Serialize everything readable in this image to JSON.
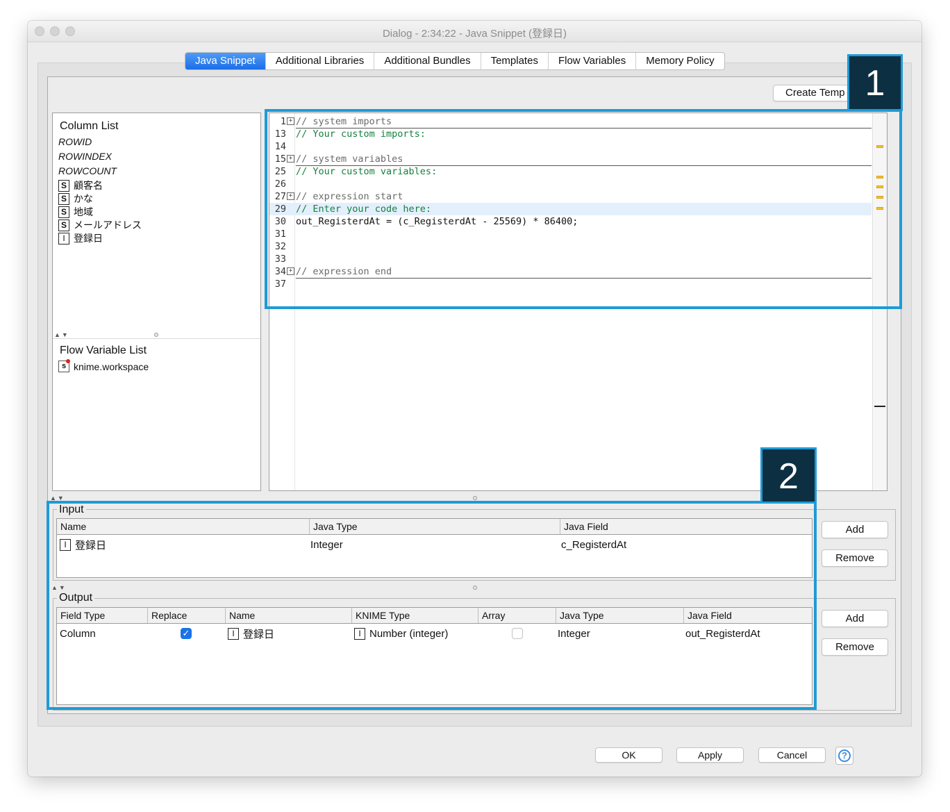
{
  "window": {
    "title": "Dialog - 2:34:22 - Java Snippet (登録日)"
  },
  "tabs": [
    {
      "label": "Java Snippet",
      "active": true
    },
    {
      "label": "Additional Libraries",
      "active": false
    },
    {
      "label": "Additional Bundles",
      "active": false
    },
    {
      "label": "Templates",
      "active": false
    },
    {
      "label": "Flow Variables",
      "active": false
    },
    {
      "label": "Memory Policy",
      "active": false
    }
  ],
  "toolbar": {
    "create_template_label": "Create Temp"
  },
  "column_list": {
    "title": "Column List",
    "items": [
      {
        "label": "ROWID",
        "type": ""
      },
      {
        "label": "ROWINDEX",
        "type": ""
      },
      {
        "label": "ROWCOUNT",
        "type": ""
      },
      {
        "label": "顧客名",
        "type": "S"
      },
      {
        "label": "かな",
        "type": "S"
      },
      {
        "label": "地域",
        "type": "S"
      },
      {
        "label": "メールアドレス",
        "type": "S"
      },
      {
        "label": "登録日",
        "type": "I"
      }
    ]
  },
  "flow_variable_list": {
    "title": "Flow Variable List",
    "items": [
      {
        "label": "knime.workspace",
        "type": "s"
      }
    ]
  },
  "editor": {
    "lines": [
      {
        "num": "1",
        "text": "// system imports",
        "kind": "sep",
        "fold": true
      },
      {
        "num": "13",
        "text": "// Your custom imports:",
        "kind": "comment"
      },
      {
        "num": "14",
        "text": "",
        "kind": "plain"
      },
      {
        "num": "15",
        "text": "// system variables",
        "kind": "sep",
        "fold": true
      },
      {
        "num": "25",
        "text": "// Your custom variables:",
        "kind": "comment"
      },
      {
        "num": "26",
        "text": "",
        "kind": "plain"
      },
      {
        "num": "27",
        "text": "// expression start",
        "kind": "sep",
        "fold": true
      },
      {
        "num": "29",
        "text": "// Enter your code here:",
        "kind": "comment",
        "highlight": true
      },
      {
        "num": "30",
        "text": "out_RegisterdAt = (c_RegisterdAt - 25569) * 86400;",
        "kind": "plain"
      },
      {
        "num": "31",
        "text": "",
        "kind": "plain"
      },
      {
        "num": "32",
        "text": "",
        "kind": "plain"
      },
      {
        "num": "33",
        "text": "",
        "kind": "plain"
      },
      {
        "num": "34",
        "text": "// expression end",
        "kind": "sep",
        "fold": true
      },
      {
        "num": "37",
        "text": "",
        "kind": "plain"
      }
    ]
  },
  "input": {
    "label": "Input",
    "headers": [
      "Name",
      "Java Type",
      "Java Field"
    ],
    "rows": [
      {
        "type": "I",
        "name": "登録日",
        "java_type": "Integer",
        "java_field": "c_RegisterdAt"
      }
    ],
    "add_label": "Add",
    "remove_label": "Remove"
  },
  "output": {
    "label": "Output",
    "headers": [
      "Field Type",
      "Replace",
      "Name",
      "KNIME Type",
      "Array",
      "Java Type",
      "Java Field"
    ],
    "rows": [
      {
        "field_type": "Column",
        "replace": true,
        "type": "I",
        "name": "登録日",
        "knime_type_badge": "I",
        "knime_type": "Number (integer)",
        "array": false,
        "java_type": "Integer",
        "java_field": "out_RegisterdAt"
      }
    ],
    "add_label": "Add",
    "remove_label": "Remove"
  },
  "footer": {
    "ok_label": "OK",
    "apply_label": "Apply",
    "cancel_label": "Cancel",
    "help_glyph": "?"
  },
  "annotations": {
    "callout_1": "1",
    "callout_2": "2",
    "highlight_color": "#1e9bd7",
    "callout_bg": "#0d2f42"
  },
  "colors": {
    "active_tab": "#1c6ee8",
    "comment_text": "#15803d",
    "highlight_line": "#e3effc",
    "checkbox_on": "#1a73e8"
  }
}
